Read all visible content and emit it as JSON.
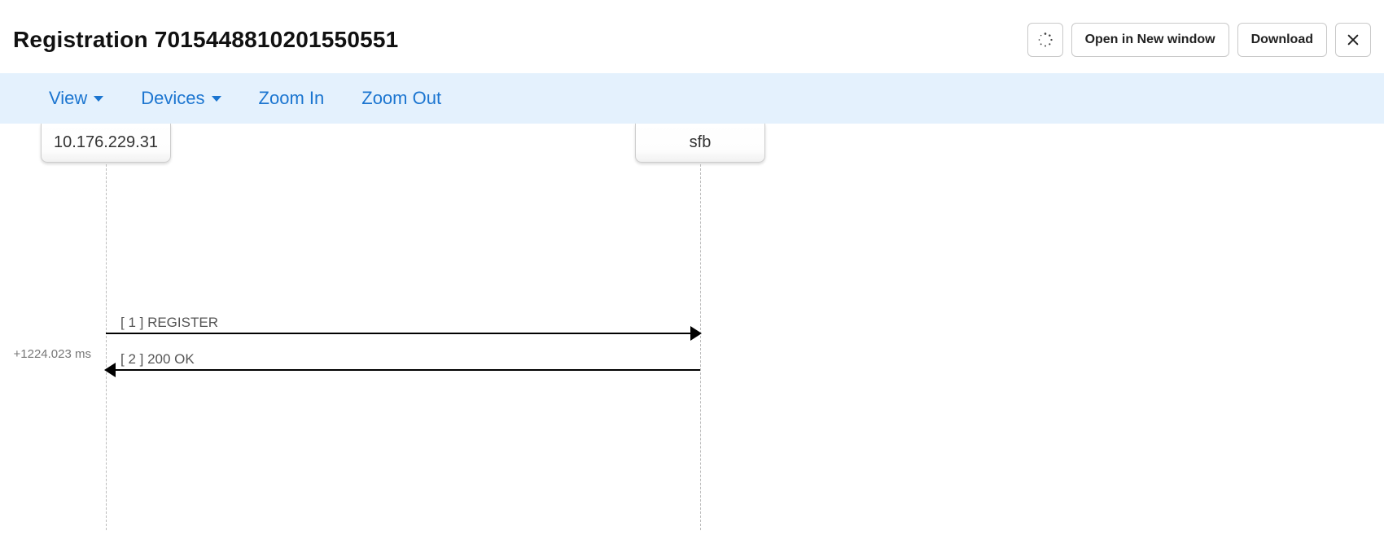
{
  "header": {
    "title": "Registration 7015448810201550551",
    "actions": {
      "open_new_window_label": "Open in New window",
      "download_label": "Download"
    }
  },
  "toolbar": {
    "view_label": "View",
    "devices_label": "Devices",
    "zoom_in_label": "Zoom In",
    "zoom_out_label": "Zoom Out"
  },
  "diagram": {
    "actors": {
      "left": "10.176.229.31",
      "right": "sfb"
    },
    "messages": [
      {
        "label": "[ 1 ] REGISTER",
        "direction": "right",
        "timestamp": ""
      },
      {
        "label": "[ 2 ] 200 OK",
        "direction": "left",
        "timestamp": "+1224.023 ms"
      }
    ]
  }
}
